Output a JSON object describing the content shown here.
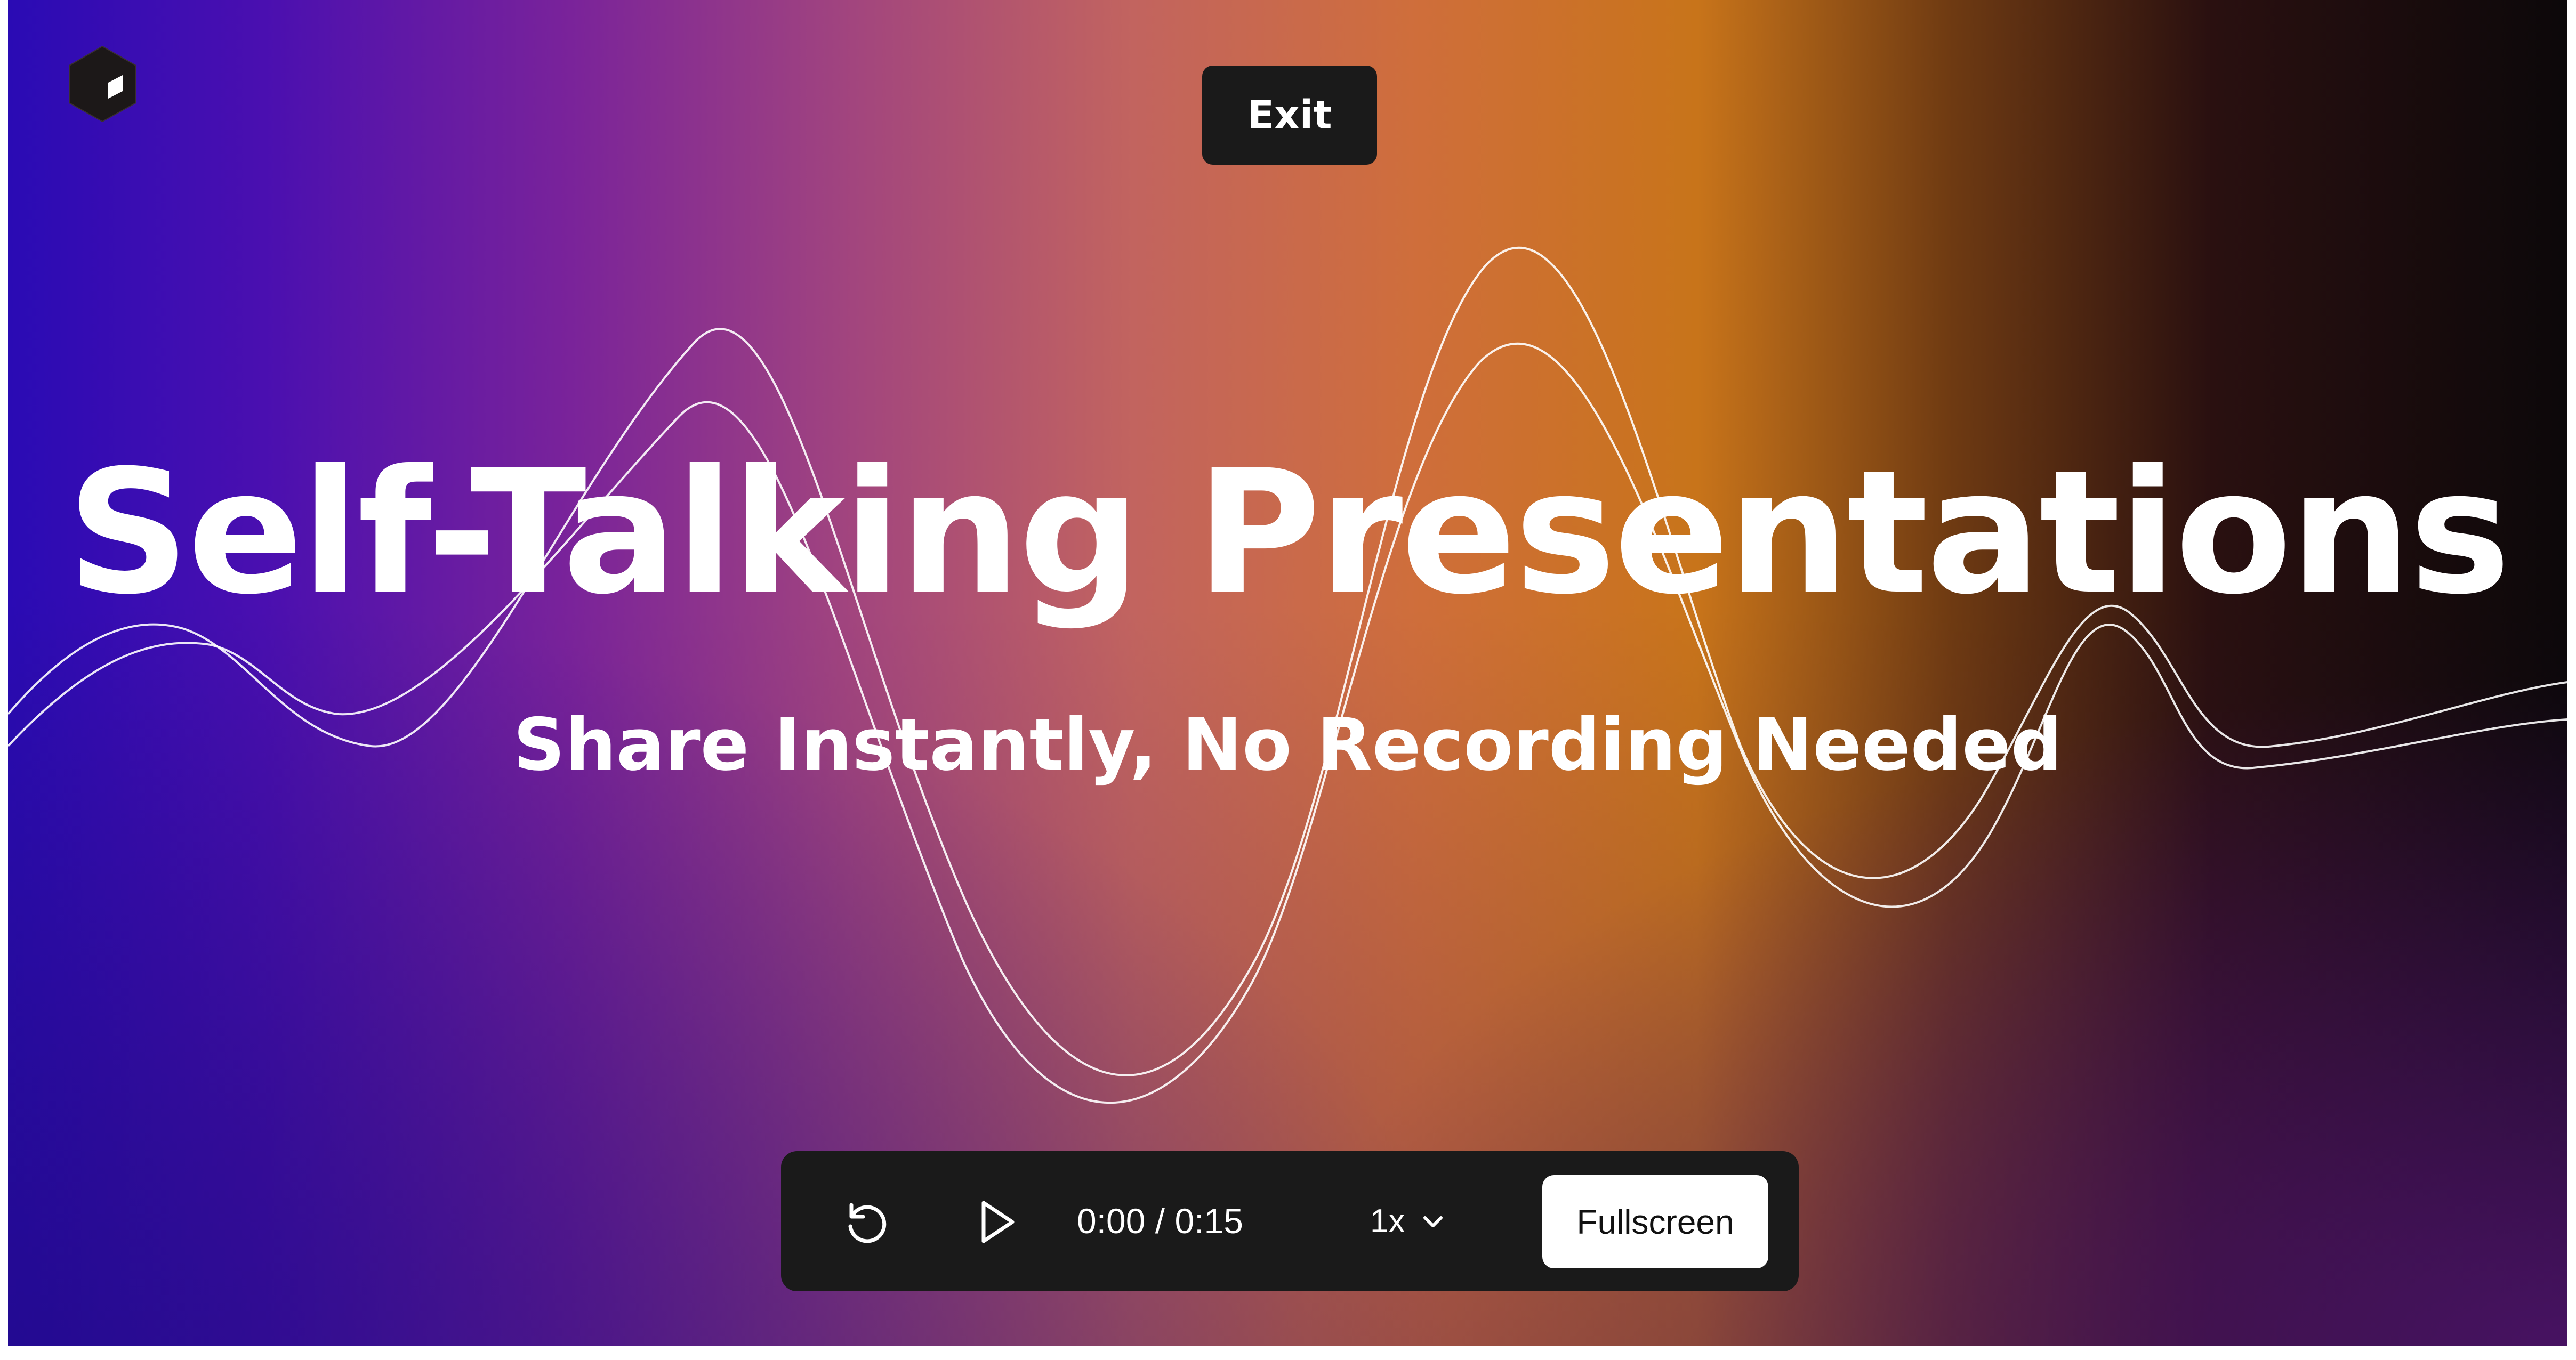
{
  "header": {
    "logo_icon": "cube-icon",
    "exit_label": "Exit"
  },
  "slide": {
    "title": "Self-Talking Presentations",
    "subtitle": "Share Instantly, No Recording Needed"
  },
  "player": {
    "replay_icon": "replay-icon",
    "play_icon": "play-icon",
    "time": "0:00 / 0:15",
    "speed": "1x",
    "speed_icon": "chevron-down-icon",
    "fullscreen_label": "Fullscreen"
  },
  "colors": {
    "control_bar": "#1a1a1a",
    "exit_button": "#1a1a1a",
    "fullscreen_button": "#ffffff",
    "gradient_start": "#2a0bb4",
    "gradient_mid": "#c2645f",
    "gradient_orange": "#c8741a",
    "gradient_end": "#0c080a"
  }
}
